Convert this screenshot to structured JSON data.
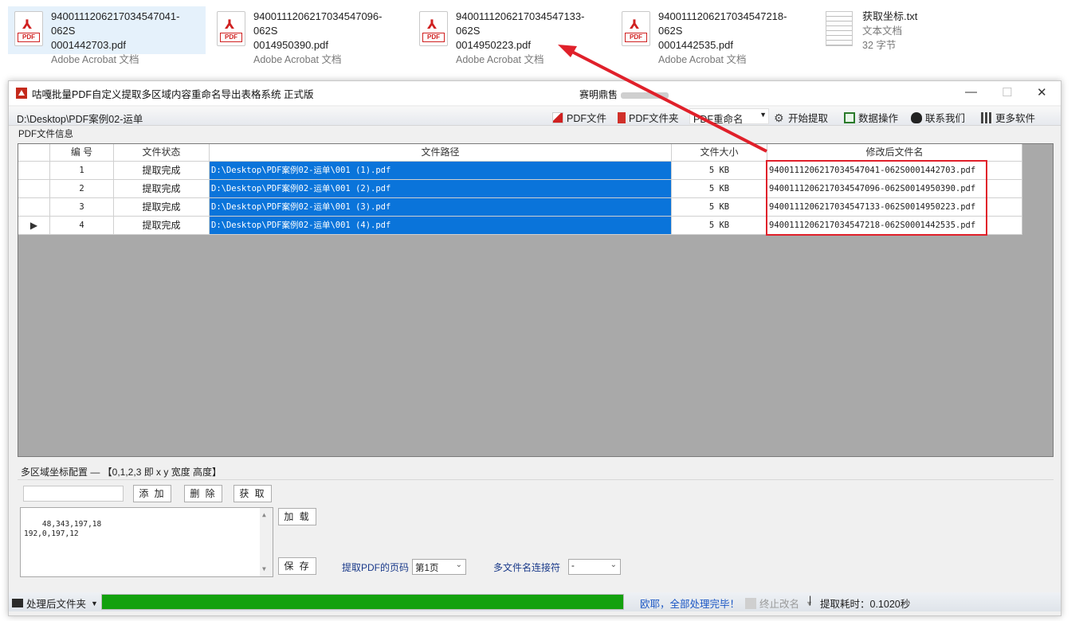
{
  "explorer": {
    "files": [
      {
        "line1": "94001112062170345470​41-062S",
        "line2": "0001442703.pdf",
        "type": "Adobe Acrobat 文档",
        "icon": "pdf-file-icon"
      },
      {
        "line1": "94001112062170345470​96-062S",
        "line2": "0014950390.pdf",
        "type": "Adobe Acrobat 文档",
        "icon": "pdf-file-icon"
      },
      {
        "line1": "940011120621703454713​3-062S",
        "line2": "0014950223.pdf",
        "type": "Adobe Acrobat 文档",
        "icon": "pdf-file-icon"
      },
      {
        "line1": "940011120621703454721​8-062S",
        "line2": "0001442535.pdf",
        "type": "Adobe Acrobat 文档",
        "icon": "pdf-file-icon"
      }
    ],
    "txt_file": {
      "name": "获取坐标.txt",
      "type": "文本文档",
      "size": "32 字节",
      "icon": "text-file-icon"
    },
    "pdf_badge": "PDF"
  },
  "window": {
    "title": "咕嘎批量PDF自定义提取多区域内容重命名导出表格系统   正式版",
    "title_center": "赛明鼎售",
    "minimize": "—",
    "maximize": "☐",
    "close": "✕"
  },
  "toolbar": {
    "path": "D:\\Desktop\\PDF案例02-运单",
    "pdf_file": "PDF文件",
    "pdf_folder": "PDF文件夹",
    "rename_select": "PDF重命名",
    "start": "开始提取",
    "data_ops": "数据操作",
    "contact": "联系我们",
    "more": "更多软件"
  },
  "grid": {
    "group_label": "PDF文件信息",
    "columns": [
      "",
      "编 号",
      "文件状态",
      "文件路径",
      "文件大小",
      "修改后文件名"
    ],
    "rows": [
      {
        "marker": "",
        "no": "1",
        "status": "提取完成",
        "path": "D:\\Desktop\\PDF案例02-运单\\001 (1).pdf",
        "size": "5 KB",
        "new_name": "940011120621703454​7041-062S0001442703.pdf"
      },
      {
        "marker": "",
        "no": "2",
        "status": "提取完成",
        "path": "D:\\Desktop\\PDF案例02-运单\\001 (2).pdf",
        "size": "5 KB",
        "new_name": "940011120621703454​7096-062S0014950390.pdf"
      },
      {
        "marker": "",
        "no": "3",
        "status": "提取完成",
        "path": "D:\\Desktop\\PDF案例02-运单\\001 (3).pdf",
        "size": "5 KB",
        "new_name": "940011120621703454​7133-062S0014950223.pdf"
      },
      {
        "marker": "▶",
        "no": "4",
        "status": "提取完成",
        "path": "D:\\Desktop\\PDF案例02-运单\\001 (4).pdf",
        "size": "5 KB",
        "new_name": "940011120621703454​7218-062S0001442535.pdf"
      }
    ]
  },
  "config": {
    "label": "多区域坐标配置 — 【0,1,2,3 即 x y 宽度 高度】",
    "input_value": "",
    "add": "添 加",
    "delete": "删 除",
    "get": "获 取",
    "coords": "48,343,197,18\n192,0,197,12",
    "load": "加 载",
    "save": "保 存",
    "page_label": "提取PDF的页码",
    "page_value": "第1页",
    "joiner_label": "多文件名连接符",
    "joiner_value": "-"
  },
  "status": {
    "folder": "处理后文件夹",
    "progress_pct": 100,
    "message": "欧耶，全部处理完毕！",
    "stop": "终止改名",
    "separator": "|",
    "elapsed": "提取耗时：0.1020秒"
  },
  "colors": {
    "accent_blue": "#0a74da",
    "highlight_red": "#e0202a",
    "progress_green": "#13a10e"
  }
}
